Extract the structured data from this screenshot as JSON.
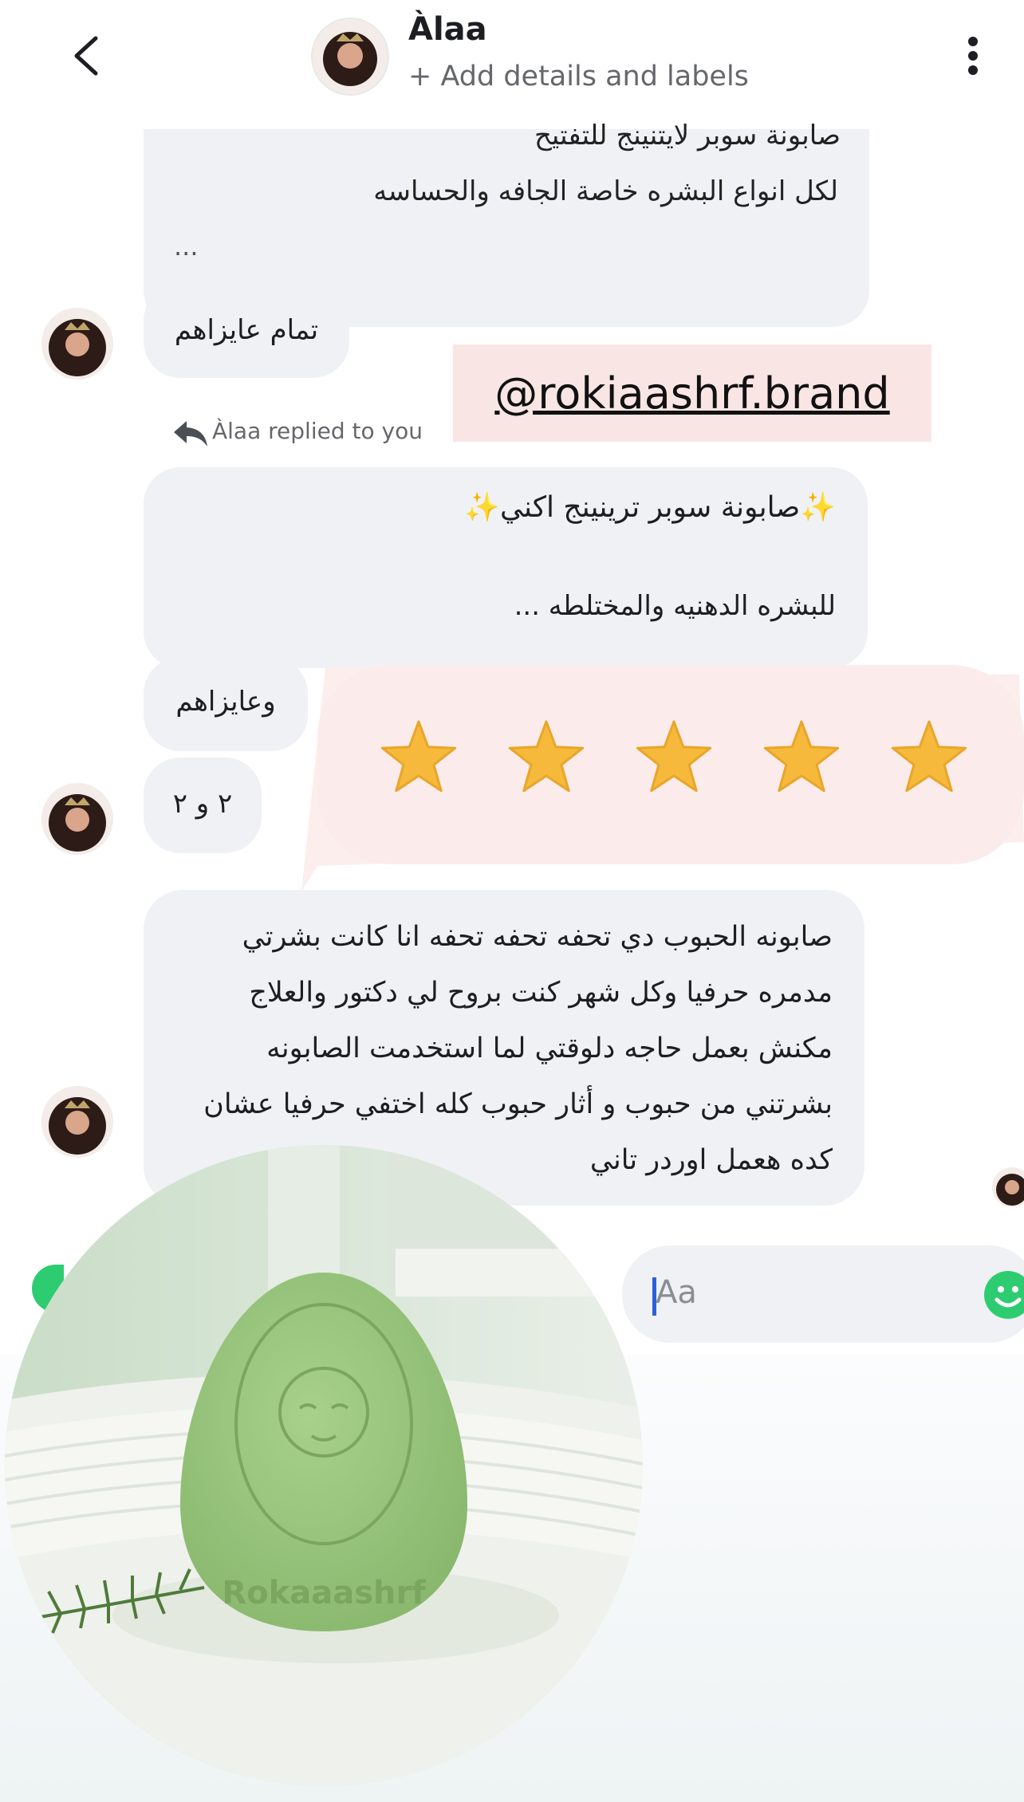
{
  "header": {
    "title": "Àlaa",
    "subtitle": "+ Add details and labels"
  },
  "messages": {
    "m1_line1": "صابونة سوبر لايتنينج للتفتيح",
    "m1_line2": "لكل انواع البشره خاصة الجافه والحساسه",
    "m1_ellipsis": "...",
    "m2": "تمام عايزاهم",
    "reply_note": "Àlaa replied to you",
    "m3_line1": "✨صابونة سوبر ترينينج اكني✨",
    "m3_line2": "للبشره الدهنيه والمختلطه ...",
    "m4": "وعايزاهم",
    "m5": "٢ و ٢",
    "m6": "صابونه الحبوب دي تحفه تحفه تحفه انا كانت بشرتي مدمره حرفيا وكل شهر كنت بروح لي دكتور والعلاج مكنش بعمل حاجه دلوقتي لما استخدمت الصابونه بشرتني من حبوب و أثار حبوب كله اختفي حرفيا عشان كده هعمل اوردر تاني"
  },
  "overlay": {
    "handle": "@rokiaashrf.brand",
    "rating": 5,
    "product_stamp": "Rokaaashrf"
  },
  "composer": {
    "placeholder": "Aa"
  },
  "colors": {
    "bubble": "#f0f1f5",
    "highlight": "#f9e6e4",
    "star": "#f6b93b",
    "emoji_green": "#2ecc71",
    "soap_green": "#9dc77f"
  }
}
